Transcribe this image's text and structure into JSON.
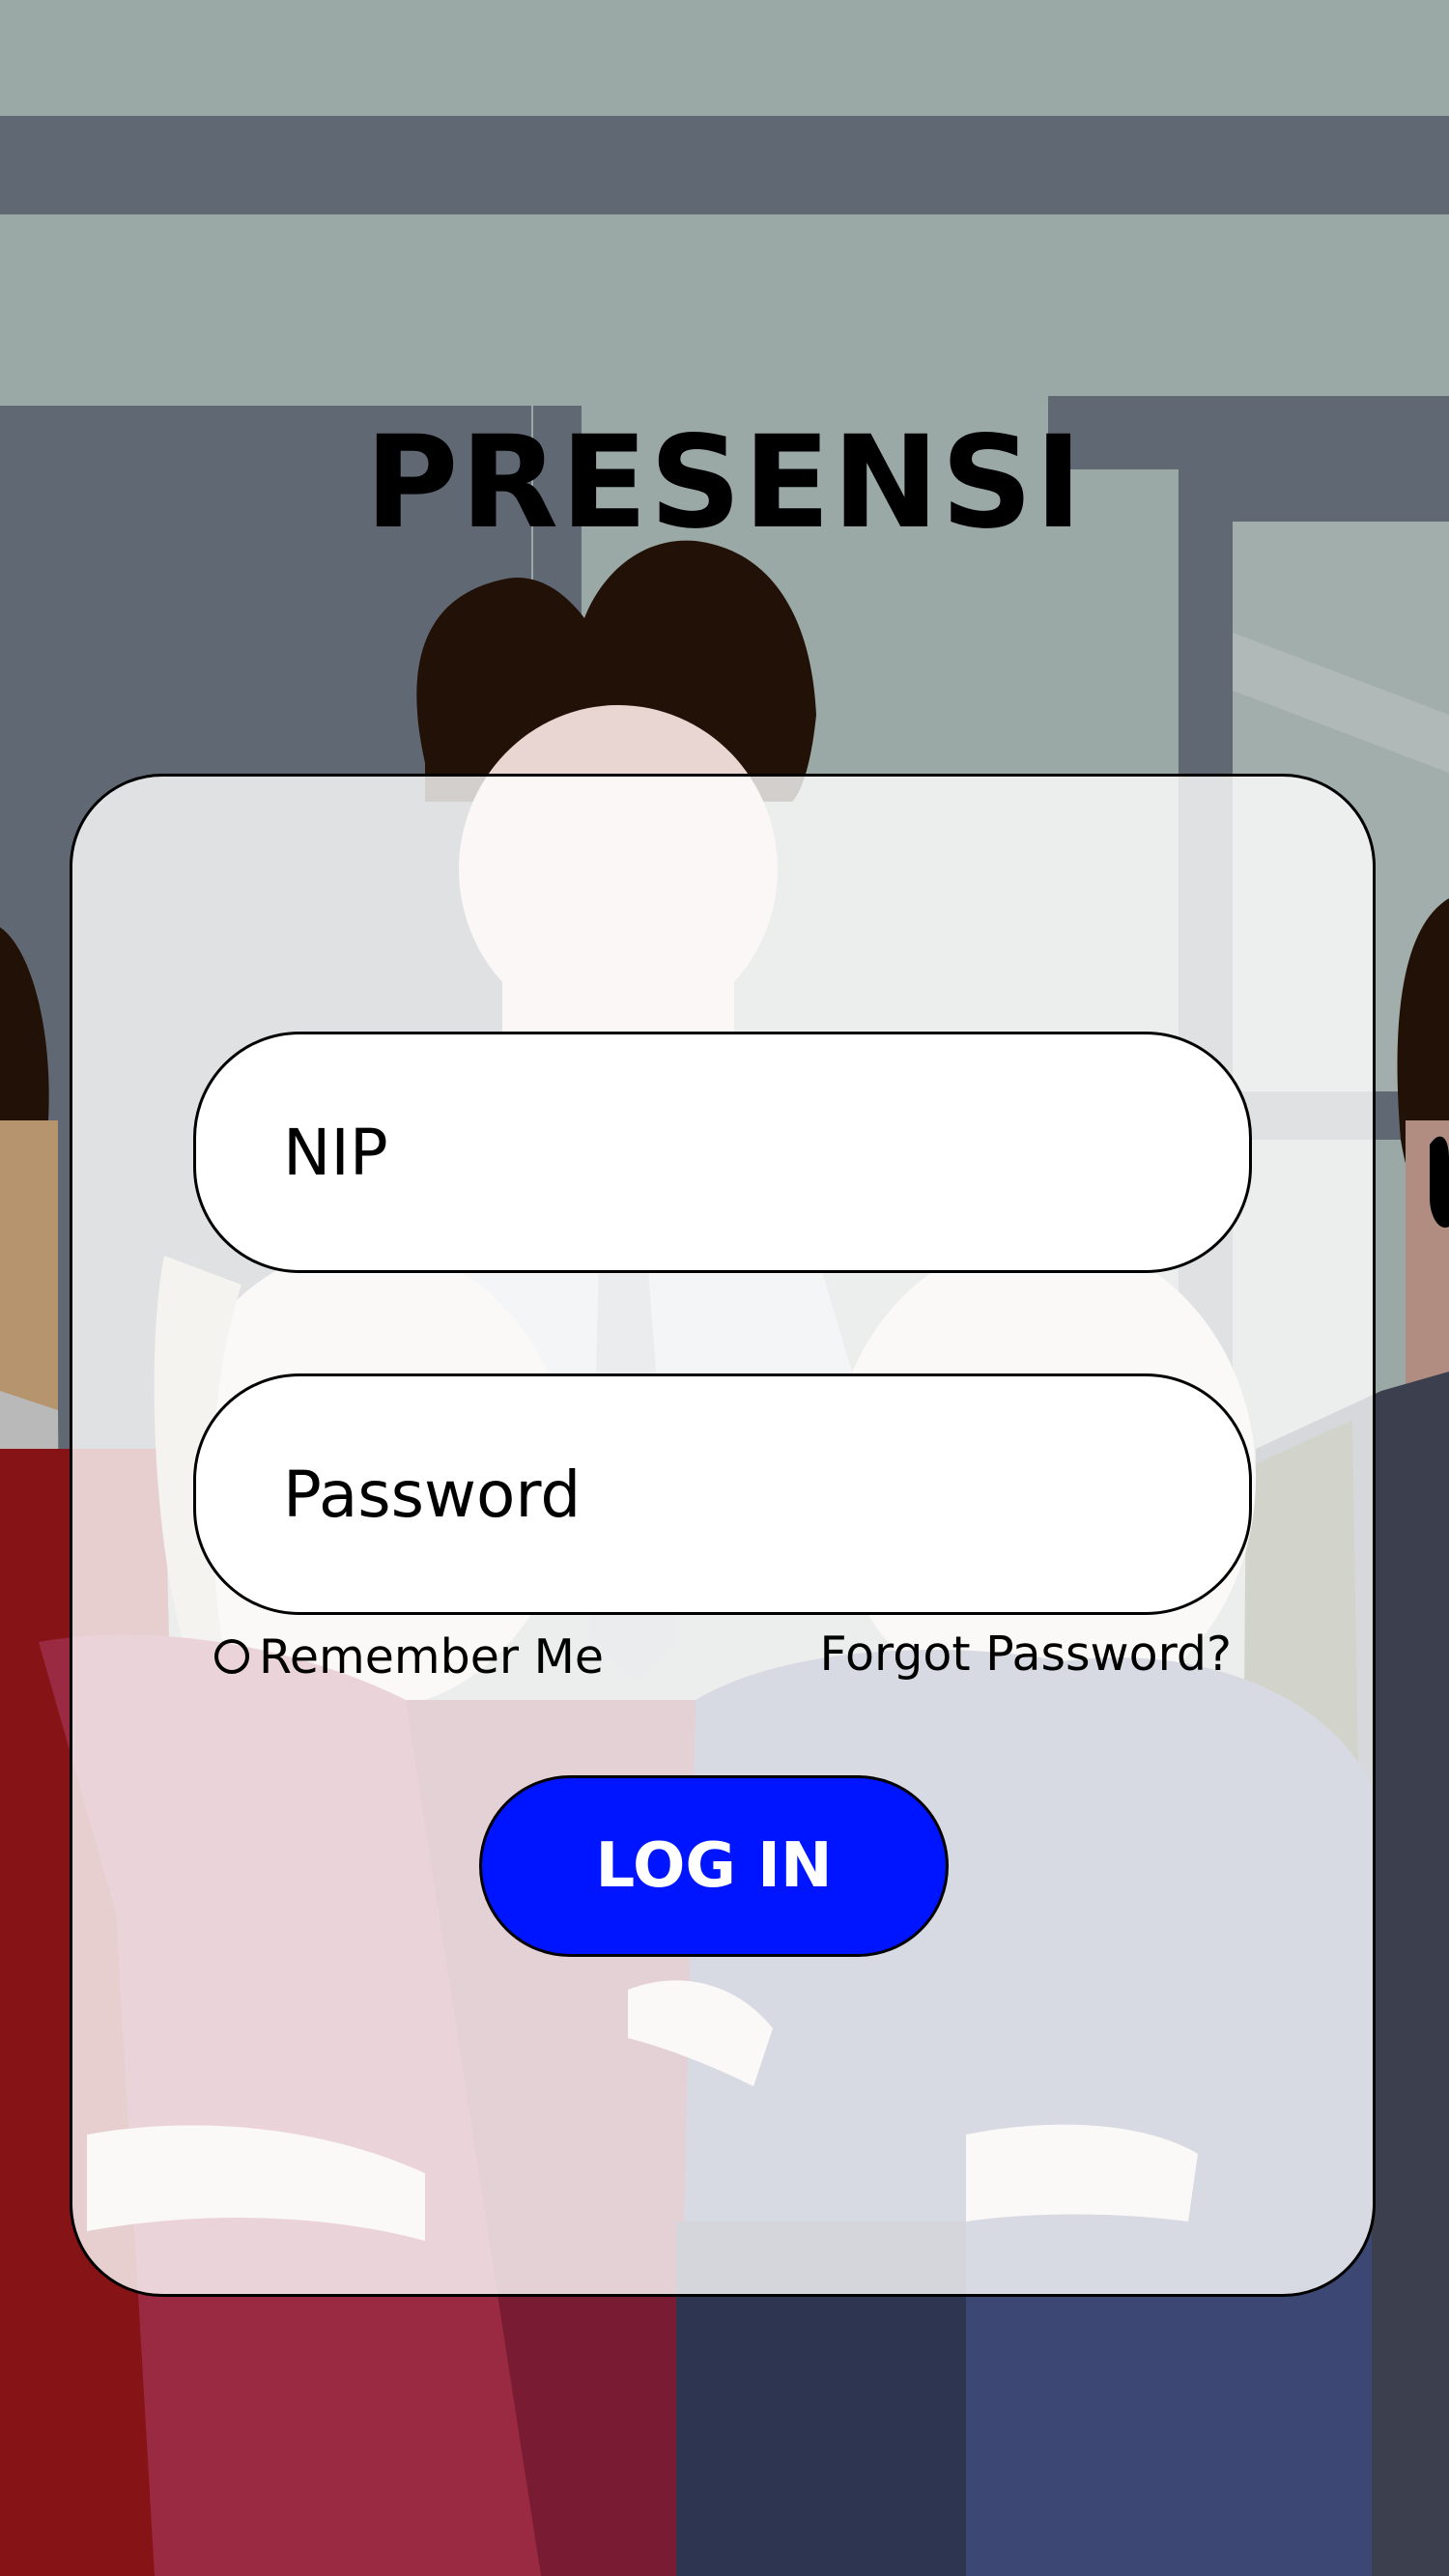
{
  "app": {
    "title": "PRESENSI"
  },
  "form": {
    "nip_placeholder": "NIP",
    "nip_value": "",
    "password_placeholder": "Password",
    "password_value": "",
    "remember_label": "Remember Me",
    "remember_checked": false,
    "forgot_label": "Forgot Password?",
    "login_label": "LOG IN"
  },
  "colors": {
    "login_button": "#0015ff",
    "login_text": "#ffffff",
    "card_background": "rgba(255,255,255,0.8)",
    "field_background": "#ffffff",
    "border": "#000000"
  },
  "background": {
    "image": "office-illustration",
    "description_icon": "people-illustration-icon"
  }
}
